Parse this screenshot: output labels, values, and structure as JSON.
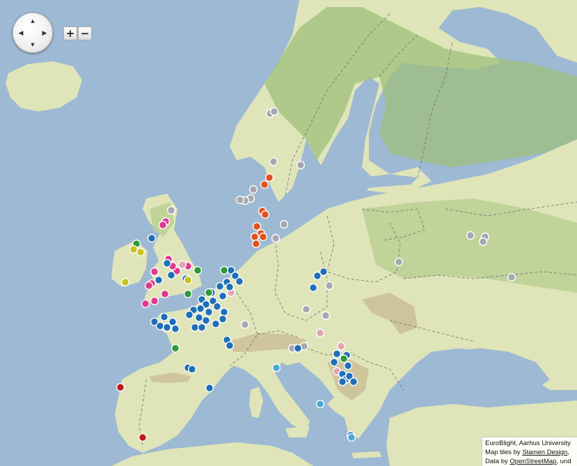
{
  "map": {
    "controls": {
      "pan_up": "▲",
      "pan_down": "▼",
      "pan_left": "◀",
      "pan_right": "▶",
      "zoom_in": "+",
      "zoom_out": "−"
    },
    "attribution": {
      "line1": "EuroBlight, Aarhus University",
      "line2_prefix": "Map tiles by ",
      "line2_link": "Stamen Design",
      "line2_suffix": ", ",
      "line3_prefix": "Data by ",
      "line3_link": "OpenStreetMap",
      "line3_suffix": ", und"
    },
    "colors": {
      "water": "#9db9d3",
      "land": "#dfe5b9",
      "forest": "#9fbf7c",
      "mountain": "#c8b994",
      "border": "#6c6c6c"
    },
    "marker_colors": {
      "blue": "#1e6fb8",
      "pink": "#e0398c",
      "grey": "#a7a7b0",
      "orange": "#e2521c",
      "green": "#2f9a3a",
      "yellow": "#c9c321",
      "red": "#c21a1a",
      "lightpink": "#e3a3b1",
      "lightblue": "#4ea8d6"
    }
  }
}
